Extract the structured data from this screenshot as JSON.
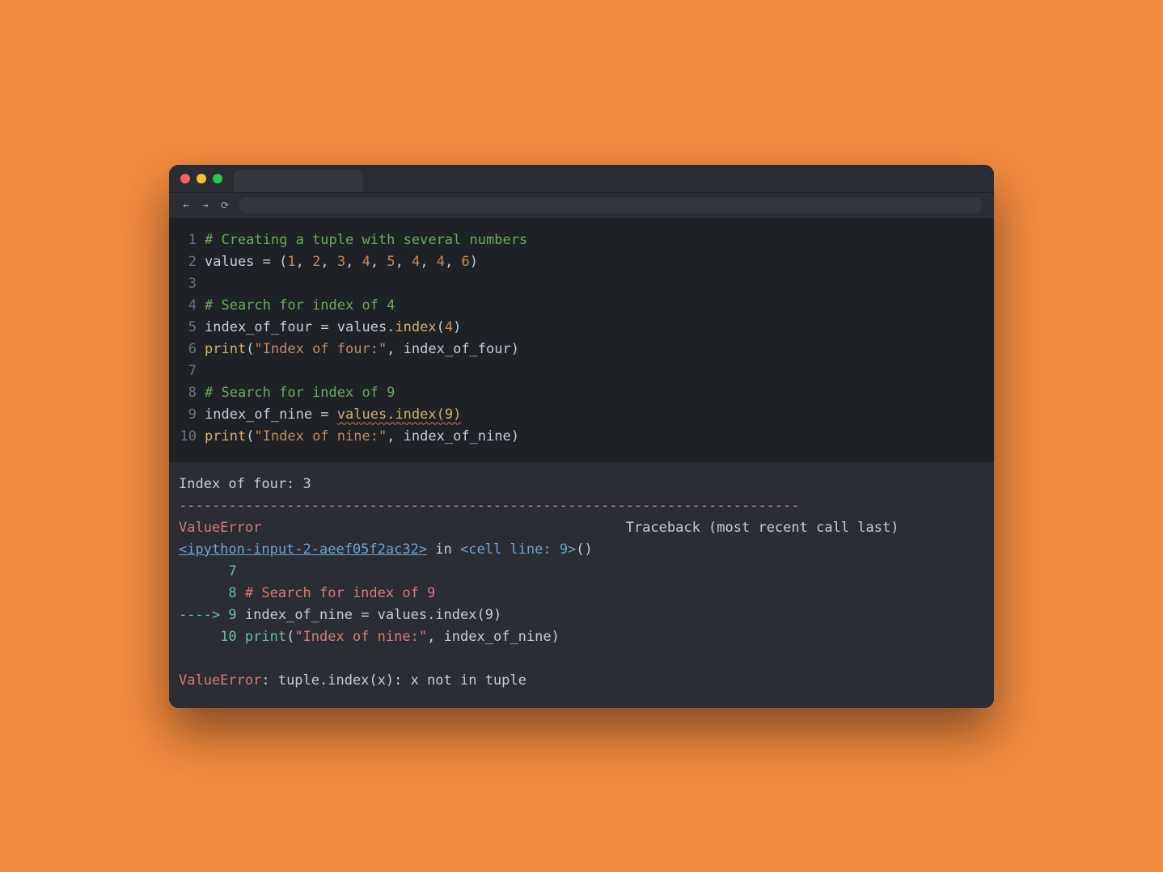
{
  "code": {
    "lines": [
      {
        "n": "1",
        "segs": [
          {
            "t": "# Creating a tuple with several numbers",
            "c": "tok-comment"
          }
        ]
      },
      {
        "n": "2",
        "segs": [
          {
            "t": "values ",
            "c": "code"
          },
          {
            "t": "=",
            "c": "tok-op"
          },
          {
            "t": " (",
            "c": "code"
          },
          {
            "t": "1",
            "c": "tok-num"
          },
          {
            "t": ", ",
            "c": "code"
          },
          {
            "t": "2",
            "c": "tok-num"
          },
          {
            "t": ", ",
            "c": "code"
          },
          {
            "t": "3",
            "c": "tok-num"
          },
          {
            "t": ", ",
            "c": "code"
          },
          {
            "t": "4",
            "c": "tok-num"
          },
          {
            "t": ", ",
            "c": "code"
          },
          {
            "t": "5",
            "c": "tok-num"
          },
          {
            "t": ", ",
            "c": "code"
          },
          {
            "t": "4",
            "c": "tok-num"
          },
          {
            "t": ", ",
            "c": "code"
          },
          {
            "t": "4",
            "c": "tok-num"
          },
          {
            "t": ", ",
            "c": "code"
          },
          {
            "t": "6",
            "c": "tok-num"
          },
          {
            "t": ")",
            "c": "code"
          }
        ]
      },
      {
        "n": "3",
        "segs": [
          {
            "t": "",
            "c": "code"
          }
        ]
      },
      {
        "n": "4",
        "segs": [
          {
            "t": "# Search for index of 4",
            "c": "tok-comment"
          }
        ]
      },
      {
        "n": "5",
        "segs": [
          {
            "t": "index_of_four ",
            "c": "code"
          },
          {
            "t": "=",
            "c": "tok-op"
          },
          {
            "t": " values.",
            "c": "code"
          },
          {
            "t": "index",
            "c": "tok-func"
          },
          {
            "t": "(",
            "c": "code"
          },
          {
            "t": "4",
            "c": "tok-num"
          },
          {
            "t": ")",
            "c": "code"
          }
        ]
      },
      {
        "n": "6",
        "segs": [
          {
            "t": "print",
            "c": "tok-func"
          },
          {
            "t": "(",
            "c": "code"
          },
          {
            "t": "\"Index of four:\"",
            "c": "tok-str"
          },
          {
            "t": ", index_of_four)",
            "c": "code"
          }
        ]
      },
      {
        "n": "7",
        "segs": [
          {
            "t": "",
            "c": "code"
          }
        ]
      },
      {
        "n": "8",
        "segs": [
          {
            "t": "# Search for index of 9",
            "c": "tok-comment"
          }
        ]
      },
      {
        "n": "9",
        "segs": [
          {
            "t": "index_of_nine ",
            "c": "code"
          },
          {
            "t": "=",
            "c": "tok-op"
          },
          {
            "t": " ",
            "c": "code"
          },
          {
            "t": "values.index(9)",
            "c": "tok-func",
            "sq": true
          }
        ]
      },
      {
        "n": "10",
        "segs": [
          {
            "t": "print",
            "c": "tok-func"
          },
          {
            "t": "(",
            "c": "code"
          },
          {
            "t": "\"Index of nine:\"",
            "c": "tok-str"
          },
          {
            "t": ", index_of_nine)",
            "c": "code"
          }
        ]
      }
    ]
  },
  "output": {
    "stdout": "Index of four: 3",
    "dash": "---------------------------------------------------------------------------",
    "err_header_left": "ValueError",
    "err_header_right": "Traceback (most recent call last)",
    "link": "<ipython-input-2-aeef05f2ac32>",
    "link_suffix": " in ",
    "cell_line": "<cell line: 9>",
    "cell_paren": "()",
    "l7_num": "      7",
    "l8_num": "      8 ",
    "l8_text": "# Search for index of 9",
    "arrow": "----> ",
    "l9_num": "9 ",
    "l9_text": "index_of_nine = values.index(9)",
    "l10_num": "     10 ",
    "l10_segs": [
      {
        "t": "print",
        "c": "out-green"
      },
      {
        "t": "(",
        "c": "out-plain"
      },
      {
        "t": "\"Index of nine:\"",
        "c": "out-red2"
      },
      {
        "t": ", index_of_nine)",
        "c": "out-plain"
      }
    ],
    "final_err": "ValueError",
    "final_msg": ": tuple.index(x): x not in tuple"
  }
}
